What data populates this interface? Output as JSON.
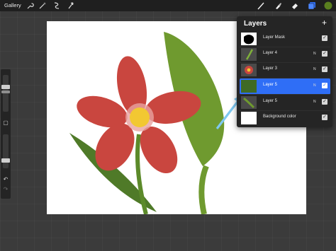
{
  "toolbar": {
    "gallery_label": "Gallery",
    "color_swatch": "#5a7f1f"
  },
  "layers": {
    "title": "Layers",
    "add_symbol": "+",
    "items": [
      {
        "name": "Layer Mask",
        "blend": "",
        "visible": true,
        "active": false
      },
      {
        "name": "Layer 4",
        "blend": "N",
        "visible": true,
        "active": false
      },
      {
        "name": "Layer 3",
        "blend": "N",
        "visible": true,
        "active": false
      },
      {
        "name": "Layer 5",
        "blend": "N",
        "visible": true,
        "active": true
      },
      {
        "name": "Layer 5",
        "blend": "N",
        "visible": true,
        "active": false
      },
      {
        "name": "Background color",
        "blend": "",
        "visible": true,
        "active": false
      }
    ]
  },
  "colors": {
    "accent": "#2f6ef6",
    "petal": "#c9463f",
    "center": "#f2c832",
    "leaf": "#6f9a2f",
    "arrow": "#7fc8f0"
  }
}
